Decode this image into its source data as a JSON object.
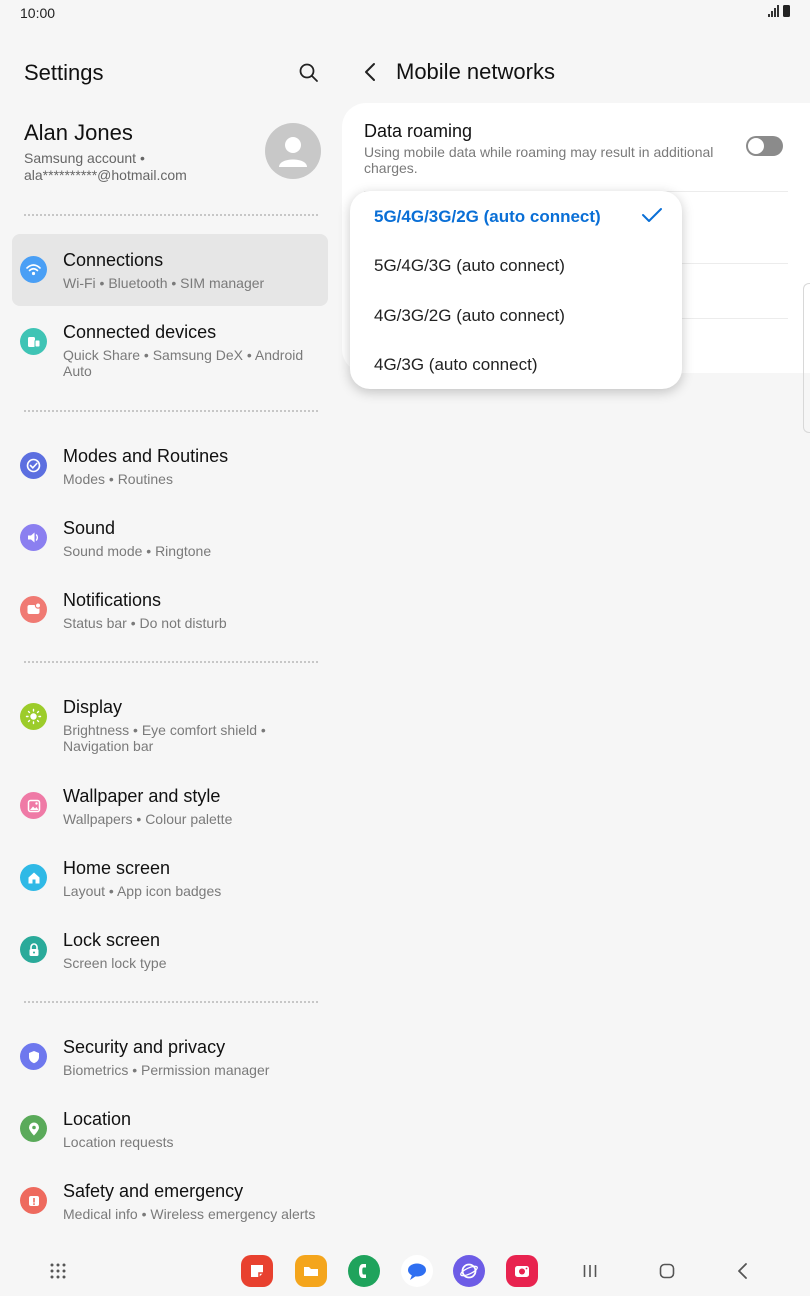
{
  "status": {
    "time": "10:00"
  },
  "left": {
    "title": "Settings",
    "profile": {
      "name": "Alan Jones",
      "line1": "Samsung account  •",
      "line2": "ala**********@hotmail.com"
    },
    "items": [
      {
        "title": "Connections",
        "sub": "Wi-Fi  •  Bluetooth  •  SIM manager"
      },
      {
        "title": "Connected devices",
        "sub": "Quick Share  •  Samsung DeX  •  Android Auto"
      },
      {
        "title": "Modes and Routines",
        "sub": "Modes  •  Routines"
      },
      {
        "title": "Sound",
        "sub": "Sound mode  •  Ringtone"
      },
      {
        "title": "Notifications",
        "sub": "Status bar  •  Do not disturb"
      },
      {
        "title": "Display",
        "sub": "Brightness  •  Eye comfort shield  •  Navigation bar"
      },
      {
        "title": "Wallpaper and style",
        "sub": "Wallpapers  •  Colour palette"
      },
      {
        "title": "Home screen",
        "sub": "Layout  •  App icon badges"
      },
      {
        "title": "Lock screen",
        "sub": "Screen lock type"
      },
      {
        "title": "Security and privacy",
        "sub": "Biometrics  •  Permission manager"
      },
      {
        "title": "Location",
        "sub": "Location requests"
      },
      {
        "title": "Safety and emergency",
        "sub": "Medical info  •  Wireless emergency alerts"
      }
    ]
  },
  "right": {
    "title": "Mobile networks",
    "data_roaming": {
      "title": "Data roaming",
      "sub": "Using mobile data while roaming may result in additional charges.",
      "enabled": false
    }
  },
  "popup": {
    "options": [
      "5G/4G/3G/2G (auto connect)",
      "5G/4G/3G (auto connect)",
      "4G/3G/2G (auto connect)",
      "4G/3G (auto connect)"
    ],
    "selected_index": 0
  },
  "colors": {
    "accent": "#0a6fd6",
    "connections": "#4a9ff5",
    "connected_devices": "#3fc4b5",
    "modes": "#5c6fe0",
    "sound": "#8b7ff0",
    "notifications": "#f07a73",
    "display": "#9ccc2a",
    "wallpaper": "#ef7aa6",
    "home": "#2fb9e6",
    "lock": "#2aaa9a",
    "security": "#6e78ee",
    "location": "#5aaa5a",
    "safety": "#ee6a5e"
  }
}
